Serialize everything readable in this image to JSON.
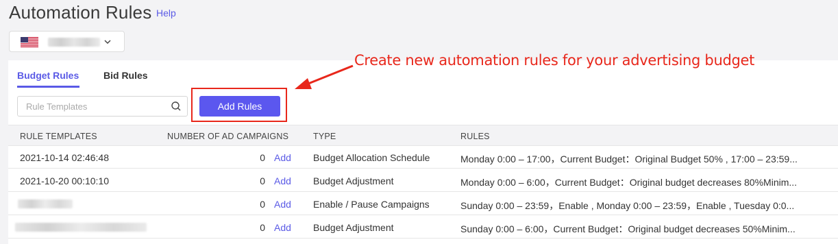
{
  "header": {
    "title": "Automation Rules",
    "help_label": "Help"
  },
  "store_selector": {
    "flag_icon": "us-flag-icon"
  },
  "tabs": [
    {
      "label": "Budget Rules",
      "active": true
    },
    {
      "label": "Bid Rules",
      "active": false
    }
  ],
  "search": {
    "placeholder": "Rule Templates",
    "value": ""
  },
  "toolbar": {
    "add_rules_label": "Add Rules"
  },
  "annotation": {
    "text": "Create new automation rules for your advertising budget",
    "color": "#e8271b"
  },
  "table": {
    "columns": [
      "RULE TEMPLATES",
      "NUMBER OF AD CAMPAIGNS",
      "TYPE",
      "RULES"
    ],
    "rows": [
      {
        "template": "2021-10-14 02:46:48",
        "count": "0",
        "action": "Add",
        "type": "Budget Allocation Schedule",
        "rules": "Monday  0:00 – 17:00，Current Budget：Original Budget 50% , 17:00 – 23:59..."
      },
      {
        "template": "2021-10-20 00:10:10",
        "count": "0",
        "action": "Add",
        "type": "Budget Adjustment",
        "rules": "Monday  0:00 – 6:00，Current Budget：Original budget decreases 80%Minim..."
      },
      {
        "template": "",
        "count": "0",
        "action": "Add",
        "type": "Enable / Pause Campaigns",
        "rules": "Sunday  0:00 – 23:59，Enable , Monday  0:00 – 23:59，Enable , Tuesday  0:0..."
      },
      {
        "template": "",
        "count": "0",
        "action": "Add",
        "type": "Budget Adjustment",
        "rules": "Sunday  0:00 – 6:00，Current Budget：Original budget decreases 50%Minim..."
      }
    ]
  },
  "colors": {
    "accent": "#5a5ae6",
    "button": "#5b57ef",
    "highlight": "#e8271b"
  }
}
